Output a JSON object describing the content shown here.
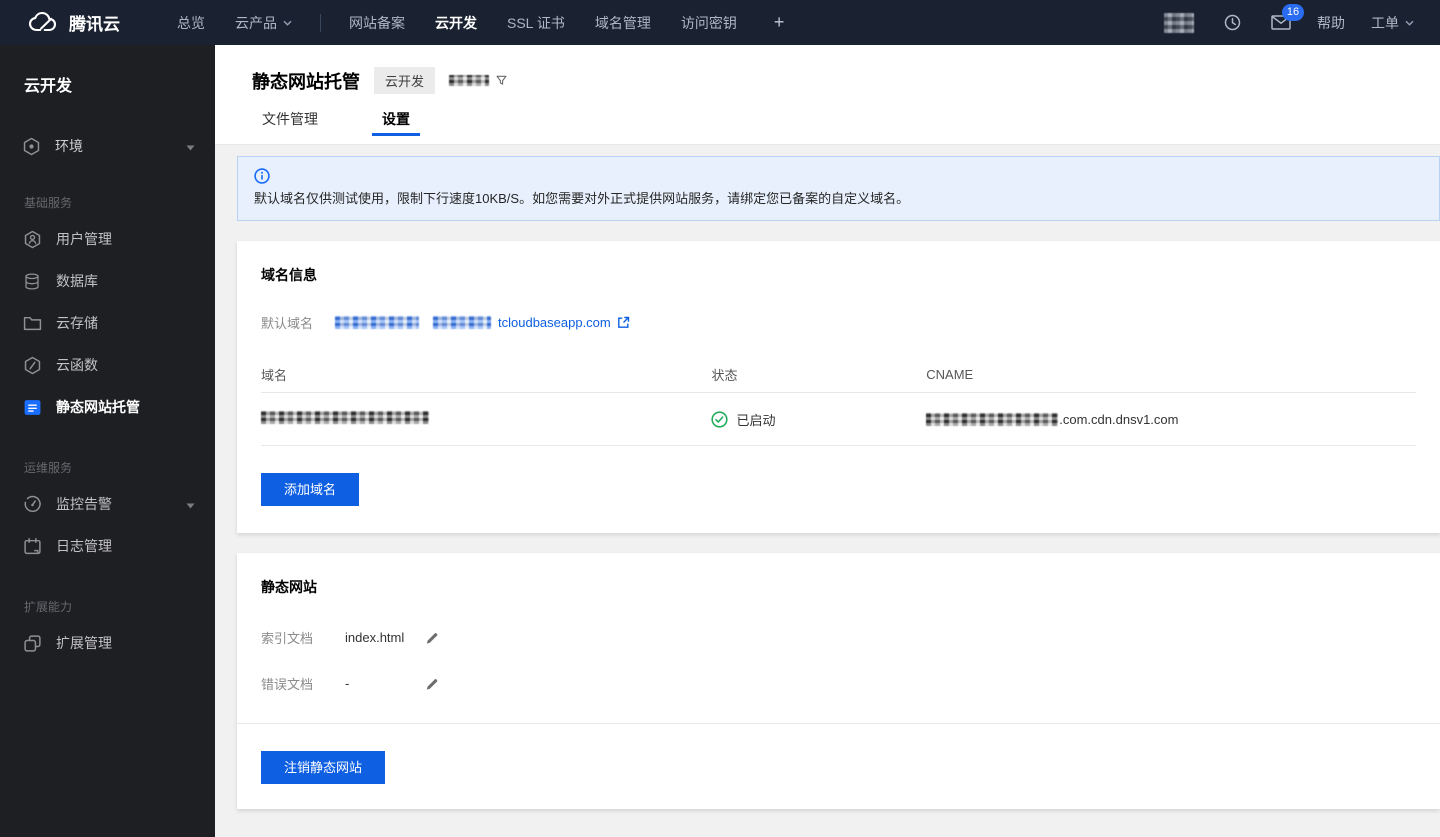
{
  "topnav": {
    "brand": "腾讯云",
    "overview": "总览",
    "products": "云产品",
    "menu": [
      "网站备案",
      "云开发",
      "SSL 证书",
      "域名管理",
      "访问密钥",
      "+"
    ],
    "active_menu": "云开发",
    "mail_badge": "16",
    "help": "帮助",
    "ticket": "工单"
  },
  "sidebar": {
    "title": "云开发",
    "env": {
      "label": "环境"
    },
    "section_basic": "基础服务",
    "items_basic": [
      "用户管理",
      "数据库",
      "云存储",
      "云函数",
      "静态网站托管"
    ],
    "section_ops": "运维服务",
    "items_ops": [
      "监控告警",
      "日志管理"
    ],
    "section_ext": "扩展能力",
    "items_ext": [
      "扩展管理"
    ],
    "active_item": "静态网站托管"
  },
  "header": {
    "title": "静态网站托管",
    "badge": "云开发",
    "tabs": [
      "文件管理",
      "设置"
    ],
    "active_tab": "设置"
  },
  "banner": {
    "text": "默认域名仅供测试使用，限制下行速度10KB/S。如您需要对外正式提供网站服务，请绑定您已备案的自定义域名。"
  },
  "domain_card": {
    "title": "域名信息",
    "default_domain_label": "默认域名",
    "default_domain_visible": "tcloudbaseapp.com",
    "table": {
      "headers": [
        "域名",
        "状态",
        "CNAME"
      ],
      "row": {
        "status": "已启动",
        "cname_visible": ".com.cdn.dnsv1.com"
      }
    },
    "add_button": "添加域名"
  },
  "site_card": {
    "title": "静态网站",
    "index_label": "索引文档",
    "index_value": "index.html",
    "error_label": "错误文档",
    "error_value": "-",
    "deregister_button": "注销静态网站"
  },
  "colors": {
    "primary_blue": "#0e5fe2",
    "status_green": "#23ad5c",
    "banner_bg": "#e7f0fc",
    "topnav_bg": "#1a2231",
    "sidebar_bg": "#1e1f23"
  }
}
